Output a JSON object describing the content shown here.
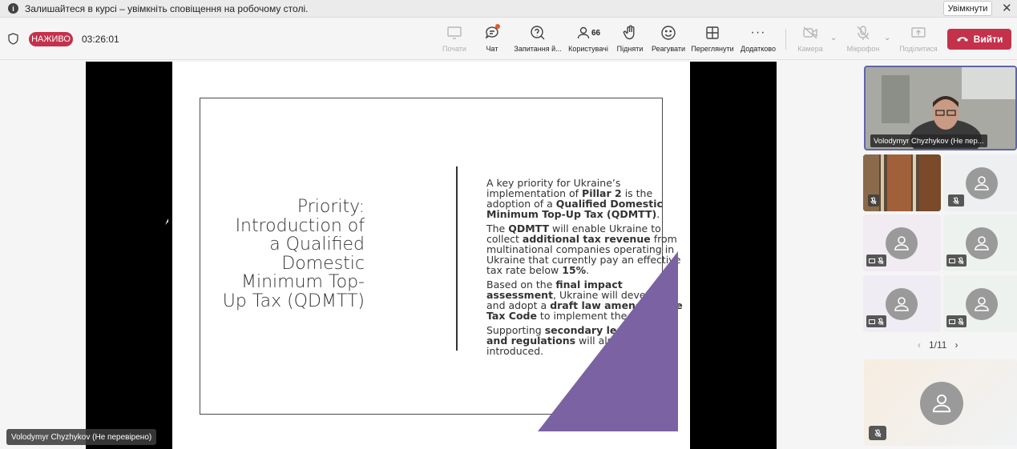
{
  "notification": {
    "message": "Залишайтеся в курсі – увімкніть сповіщення на робочому столі.",
    "enable_label": "Увімкнути",
    "close_symbol": "✕"
  },
  "meeting": {
    "live_badge": "НАЖИВО",
    "timer": "03:26:01"
  },
  "toolbar": {
    "share_label": "Почати",
    "chat_label": "Чат",
    "qa_label": "Запитання й...",
    "people_label": "Користувачі",
    "people_count": "66",
    "raise_label": "Підняти",
    "react_label": "Реагувати",
    "view_label": "Переглянути",
    "more_label": "Додатково",
    "camera_label": "Камера",
    "mic_label": "Мікрофон",
    "share_screen_label": "Поділитися",
    "leave_label": "Вийти"
  },
  "slide": {
    "title": "Priority: Introduction of a Qualified Domestic Minimum Top-Up Tax (QDMTT)",
    "accent_color": "#7b62a3",
    "p1": {
      "t1": "A key priority for Ukraine’s implementation of ",
      "b1": "Pillar 2",
      "t2": " is the adoption of a ",
      "b2": "Qualified Domestic Minimum Top-Up Tax (QDMTT)",
      "t3": "."
    },
    "p2": {
      "t1": "The ",
      "b1": "QDMTT",
      "t2": " will enable Ukraine to collect ",
      "b2": "additional tax revenue",
      "t3": " from multinational companies operating in Ukraine that currently pay an effective tax rate below ",
      "b3": "15%",
      "t4": "."
    },
    "p3": {
      "t1": "Based on the ",
      "b1": "final impact assessment",
      "t2": ", Ukraine will develop and adopt a ",
      "b2": "draft law amending the Tax Code",
      "t3": " to implement the QDMTT."
    },
    "p4": {
      "t1": "Supporting ",
      "b1": "secondary legislation and regulations",
      "t2": " will also be introduced."
    }
  },
  "presenter_label": "Volodymyr Chyzhykov (Не перевірено)",
  "participants": {
    "main_video_name": "Volodymyr Chyzhykov (Не пер...",
    "pager": "1/11"
  },
  "colors": {
    "brand_red": "#c4314b",
    "active_border": "#6264a7"
  }
}
